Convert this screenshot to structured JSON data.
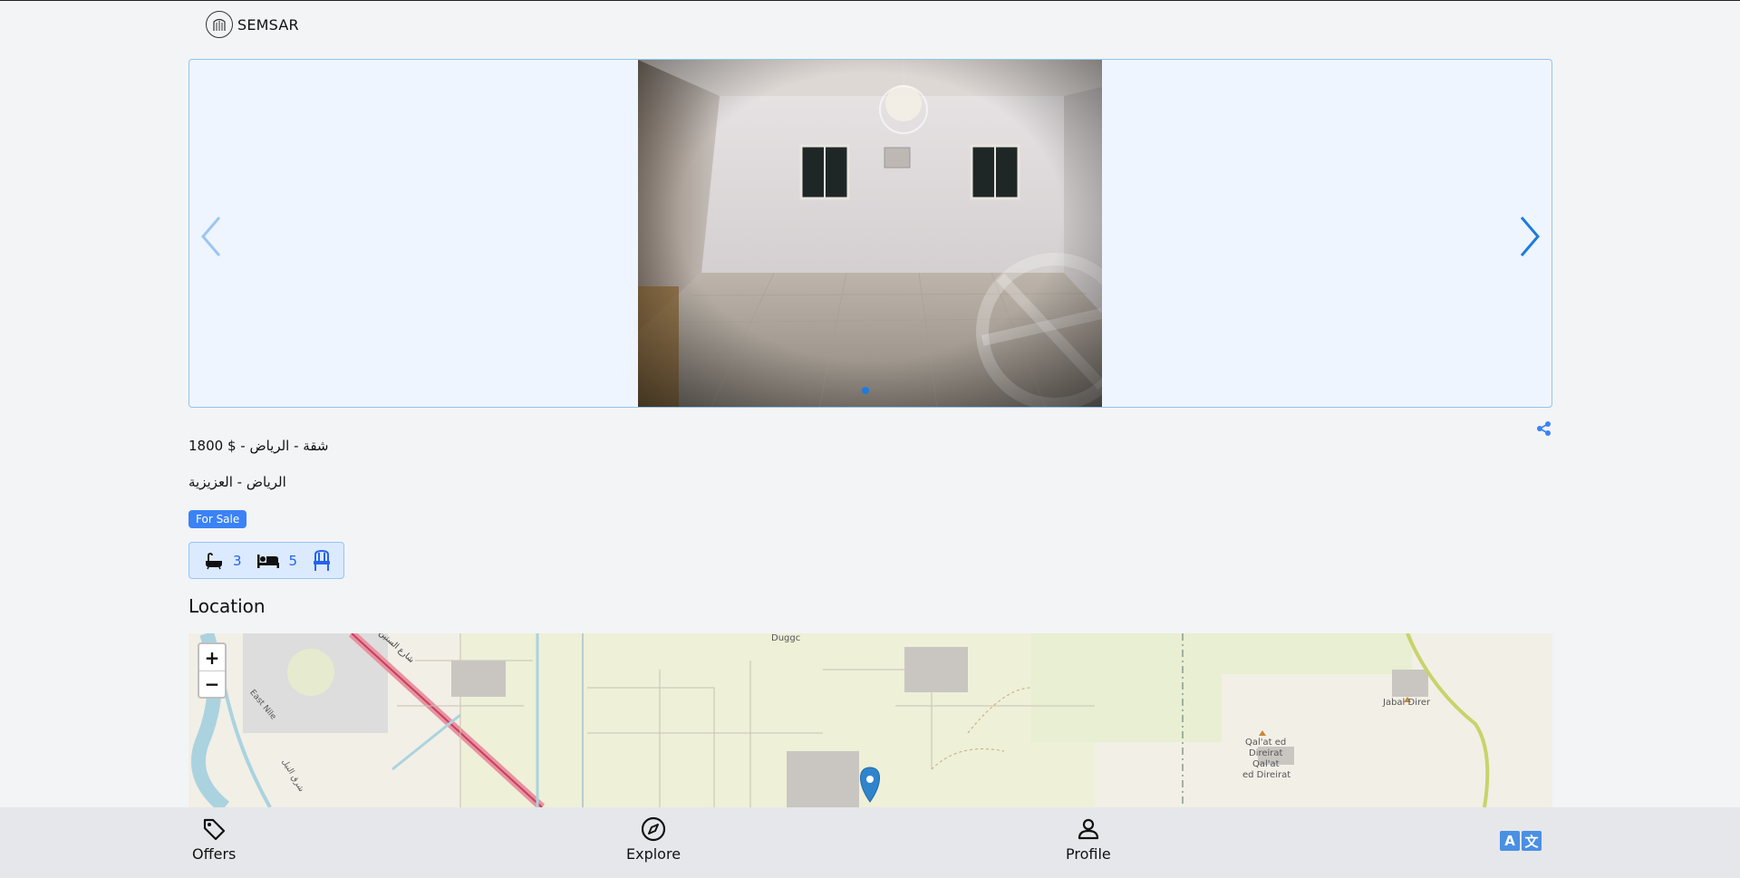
{
  "app": {
    "brand": "SEMSAR"
  },
  "listing": {
    "title": "شقة - الرياض - $ 1800",
    "address": "الرياض - العزيزية",
    "status_badge": "For Sale",
    "features": {
      "bathrooms": "3",
      "bedrooms": "5"
    }
  },
  "carousel": {
    "total_slides": 1,
    "active_slide": 1
  },
  "location": {
    "heading": "Location"
  },
  "map": {
    "zoom_in": "+",
    "zoom_out": "−",
    "labels": {
      "duggc": "Duggc",
      "east_nile": "East Nile",
      "jabal_direr": "Jabal Direr",
      "qalat_1": "Qal'at ed",
      "qalat_2": "Direirat",
      "qalat_3": "Qal'at",
      "qalat_4": "ed Direirat",
      "road_ar": "شارع الستين",
      "river_ar": "شرق النيل"
    }
  },
  "bottom_nav": {
    "offers": "Offers",
    "explore": "Explore",
    "profile": "Profile",
    "lang_a": "A",
    "lang_b": "文"
  },
  "colors": {
    "accent": "#3b82f6",
    "carousel_bg": "#eef5fe",
    "nav_bg": "#e5e7eb"
  }
}
